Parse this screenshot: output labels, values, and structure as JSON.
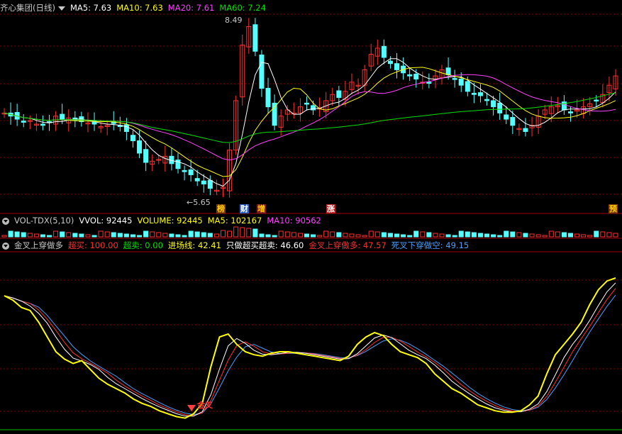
{
  "main_header": {
    "title": "齐心集团(日线)",
    "ma5": "MA5: 7.63",
    "ma10": "MA10: 7.63",
    "ma20": "MA20: 7.61",
    "ma60": "MA60: 7.24"
  },
  "vol_header": {
    "name": "VOL-TDX(5,10)",
    "vvol": "VVOL: 92445",
    "volume": "VOLUME: 92445",
    "ma5": "MA5: 102167",
    "ma10": "MA10: 90562"
  },
  "ind_header": {
    "name": "金叉上穿做多",
    "chaomai": "超买: 100.00",
    "chaomaier": "超卖: 0.00",
    "jinchang": "进场线: 42.41",
    "zhizuo": "只做超买超卖: 46.60",
    "jincha": "金叉上穿做多: 47.57",
    "sicha": "死叉下穿做空: 49.15"
  },
  "price_labels": {
    "high": "8.49",
    "low": "5.65"
  },
  "event_tags": [
    {
      "text": "榜",
      "color": "#ffcc00",
      "bg": "#7a3a00"
    },
    {
      "text": "财",
      "color": "#ffffff",
      "bg": "#2a5cb8"
    },
    {
      "text": "增",
      "color": "#ffcc00",
      "bg": "#7a1a1a"
    },
    {
      "text": "涨",
      "color": "#ffffff",
      "bg": "#b82020"
    },
    {
      "text": "预",
      "color": "#ffcc00",
      "bg": "#7a3a00"
    }
  ],
  "signal_label": "金叉",
  "colors": {
    "up": "#ff3030",
    "down": "#54ffff",
    "ma5": "#ffffff",
    "ma10": "#ffff00",
    "ma20": "#ff40ff",
    "ma60": "#00e000",
    "ind_main": "#ffff00",
    "ind_white": "#ffffff",
    "ind_red": "#ff3030",
    "ind_blue": "#4aa0ff",
    "grid": "#8b0000",
    "border": "#a00000"
  },
  "chart_data": [
    {
      "type": "candlestick",
      "title": "齐心集团(日线)",
      "series": [
        "MA5",
        "MA10",
        "MA20",
        "MA60"
      ],
      "marked_high": 8.49,
      "marked_low": 5.65,
      "last_values": {
        "MA5": 7.63,
        "MA10": 7.63,
        "MA20": 7.61,
        "MA60": 7.24
      }
    },
    {
      "type": "bar",
      "title": "VOL-TDX(5,10)",
      "last_values": {
        "VVOL": 92445,
        "VOLUME": 92445,
        "MA5": 102167,
        "MA10": 90562
      }
    },
    {
      "type": "line",
      "title": "金叉上穿做多",
      "ylim": [
        0,
        100
      ],
      "series": [
        {
          "name": "只做超买超卖",
          "last": 46.6,
          "values": [
            88,
            85,
            80,
            78,
            70,
            60,
            50,
            45,
            42,
            44,
            38,
            32,
            28,
            25,
            22,
            18,
            15,
            13,
            10,
            8,
            6,
            5,
            8,
            15,
            40,
            60,
            62,
            55,
            50,
            48,
            47,
            49,
            50,
            50,
            49,
            48,
            47,
            46,
            45,
            44,
            47,
            55,
            60,
            63,
            61,
            55,
            50,
            48,
            46,
            42,
            35,
            30,
            25,
            22,
            18,
            14,
            12,
            10,
            9,
            9,
            10,
            14,
            20,
            35,
            48,
            55,
            62,
            70,
            82,
            92,
            98,
            100
          ]
        },
        {
          "name": "金叉上穿做多",
          "last": 47.57
        },
        {
          "name": "死叉下穿做空",
          "last": 49.15
        },
        {
          "name": "进场线",
          "last": 42.41
        }
      ],
      "annotations": [
        "金叉"
      ]
    }
  ]
}
